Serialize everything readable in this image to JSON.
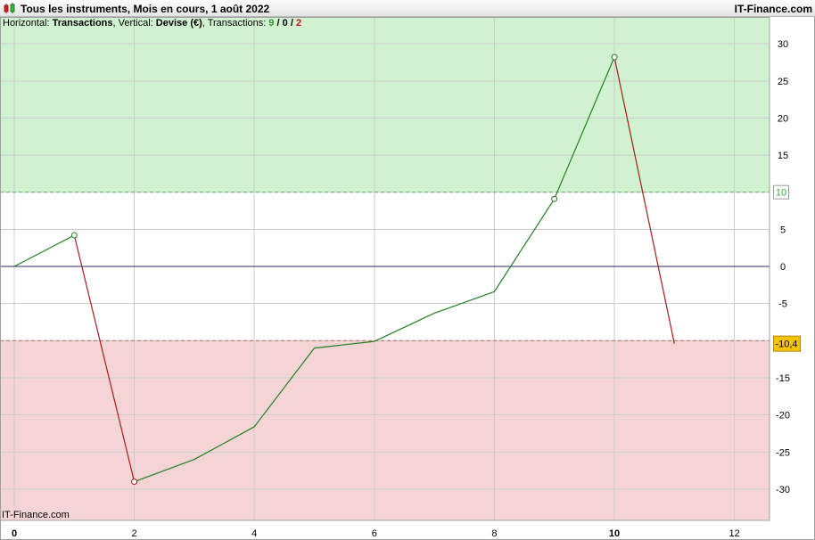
{
  "window": {
    "title": "Tous les instruments, Mois en cours, 1 août 2022",
    "brand": "IT-Finance.com",
    "watermark": "IT-Finance.com"
  },
  "subtitle": {
    "horizontal_prefix": "Horizontal: ",
    "horizontal_value": "Transactions",
    "vertical_prefix": ", Vertical: ",
    "vertical_value": "Devise (€)",
    "transactions_prefix": ", Transactions: ",
    "wins": "9",
    "sep1": " / ",
    "even": "0",
    "sep2": " / ",
    "losses": "2"
  },
  "colors": {
    "upper_zone": "#d0f2d0",
    "lower_zone": "#f4d4d4",
    "rising": "#1f7f1f",
    "falling": "#a81c1c",
    "zero_line": "#2a2a66",
    "win_text": "#2a9d2a",
    "loss_text": "#c01010",
    "last_badge": "#f5c400"
  },
  "chart_data": {
    "type": "line",
    "title": "Tous les instruments, Mois en cours, 1 août 2022",
    "xlabel": "Transactions",
    "ylabel": "Devise (€)",
    "xlim": [
      0,
      12.6
    ],
    "ylim": [
      -34.5,
      34
    ],
    "x_ticks": [
      0,
      2,
      4,
      6,
      8,
      10,
      12
    ],
    "x_ticks_bold": [
      0,
      10
    ],
    "y_ticks": [
      30,
      25,
      20,
      15,
      10,
      5,
      0,
      -5,
      -10,
      -15,
      -20,
      -25,
      -30
    ],
    "y_tick_labels": [
      "30",
      "25",
      "20",
      "15",
      "10",
      "5",
      "0",
      "-5",
      "",
      "-15",
      "-20",
      "-25",
      "-30"
    ],
    "upper_threshold": 10,
    "upper_threshold_label": "10",
    "lower_threshold": -10,
    "last_value": -10.4,
    "last_value_label": "-10,4",
    "grid": true,
    "series": [
      {
        "x": [
          0,
          1,
          2,
          3,
          4,
          5,
          6,
          7,
          8,
          9,
          10,
          11
        ],
        "values": [
          0,
          4.2,
          -29,
          -26,
          -21.6,
          -11,
          -10.1,
          -6.3,
          -3.4,
          9.1,
          28.2,
          -10.4
        ]
      }
    ],
    "markers": [
      {
        "x": 1,
        "y": 4.2
      },
      {
        "x": 2,
        "y": -29
      },
      {
        "x": 9,
        "y": 9.1
      },
      {
        "x": 10,
        "y": 28.2
      }
    ]
  }
}
